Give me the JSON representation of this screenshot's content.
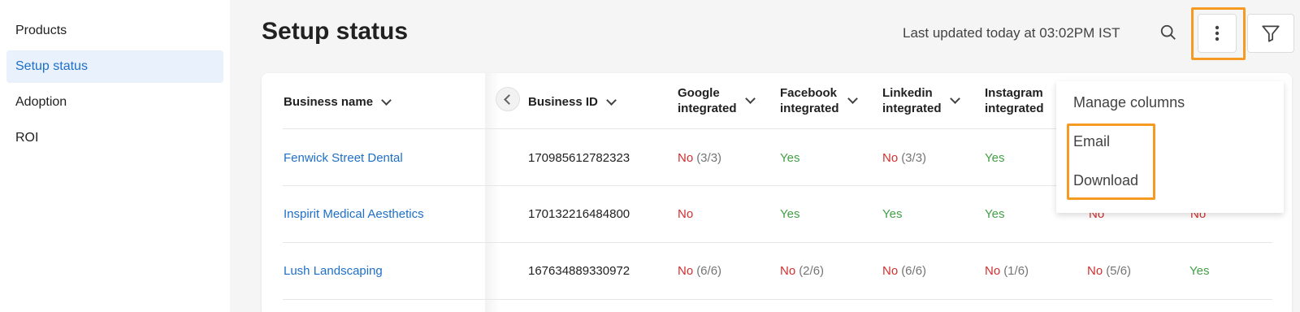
{
  "sidebar": {
    "items": [
      {
        "label": "Products",
        "active": false
      },
      {
        "label": "Setup status",
        "active": true
      },
      {
        "label": "Adoption",
        "active": false
      },
      {
        "label": "ROI",
        "active": false
      }
    ]
  },
  "header": {
    "title": "Setup status",
    "last_updated": "Last updated today at 03:02PM IST",
    "icons": [
      "search-icon",
      "more-vertical-icon",
      "filter-icon"
    ]
  },
  "table": {
    "columns": [
      {
        "line1": "Business name",
        "line2": ""
      },
      {
        "line1": "Business ID",
        "line2": ""
      },
      {
        "line1": "Google",
        "line2": "integrated"
      },
      {
        "line1": "Facebook",
        "line2": "integrated"
      },
      {
        "line1": "Linkedin",
        "line2": "integrated"
      },
      {
        "line1": "Instagram",
        "line2": "integrated"
      }
    ],
    "rows": [
      {
        "name": "Fenwick Street Dental",
        "id": "170985612782323",
        "google": {
          "status": "No",
          "count": "(3/3)"
        },
        "facebook": {
          "status": "Yes",
          "count": ""
        },
        "linkedin": {
          "status": "No",
          "count": "(3/3)"
        },
        "instagram": {
          "status": "Yes",
          "count": ""
        },
        "col7": {
          "status": "",
          "count": ""
        },
        "col8": {
          "status": "",
          "count": ""
        }
      },
      {
        "name": "Inspirit Medical Aesthetics",
        "id": "170132216484800",
        "google": {
          "status": "No",
          "count": ""
        },
        "facebook": {
          "status": "Yes",
          "count": ""
        },
        "linkedin": {
          "status": "Yes",
          "count": ""
        },
        "instagram": {
          "status": "Yes",
          "count": ""
        },
        "col7": {
          "status": "No",
          "count": ""
        },
        "col8": {
          "status": "No",
          "count": ""
        }
      },
      {
        "name": "Lush Landscaping",
        "id": "167634889330972",
        "google": {
          "status": "No",
          "count": "(6/6)"
        },
        "facebook": {
          "status": "No",
          "count": "(2/6)"
        },
        "linkedin": {
          "status": "No",
          "count": "(6/6)"
        },
        "instagram": {
          "status": "No",
          "count": "(1/6)"
        },
        "col7": {
          "status": "No",
          "count": "(5/6)"
        },
        "col8": {
          "status": "Yes",
          "count": ""
        }
      }
    ]
  },
  "menu": {
    "items": [
      {
        "label": "Manage columns"
      },
      {
        "label": "Email"
      },
      {
        "label": "Download"
      }
    ]
  },
  "colors": {
    "accent": "#1e6fc7",
    "active_bg": "#e8f1fc",
    "no": "#d32f2f",
    "yes": "#43a047",
    "highlight": "#f59a23"
  }
}
